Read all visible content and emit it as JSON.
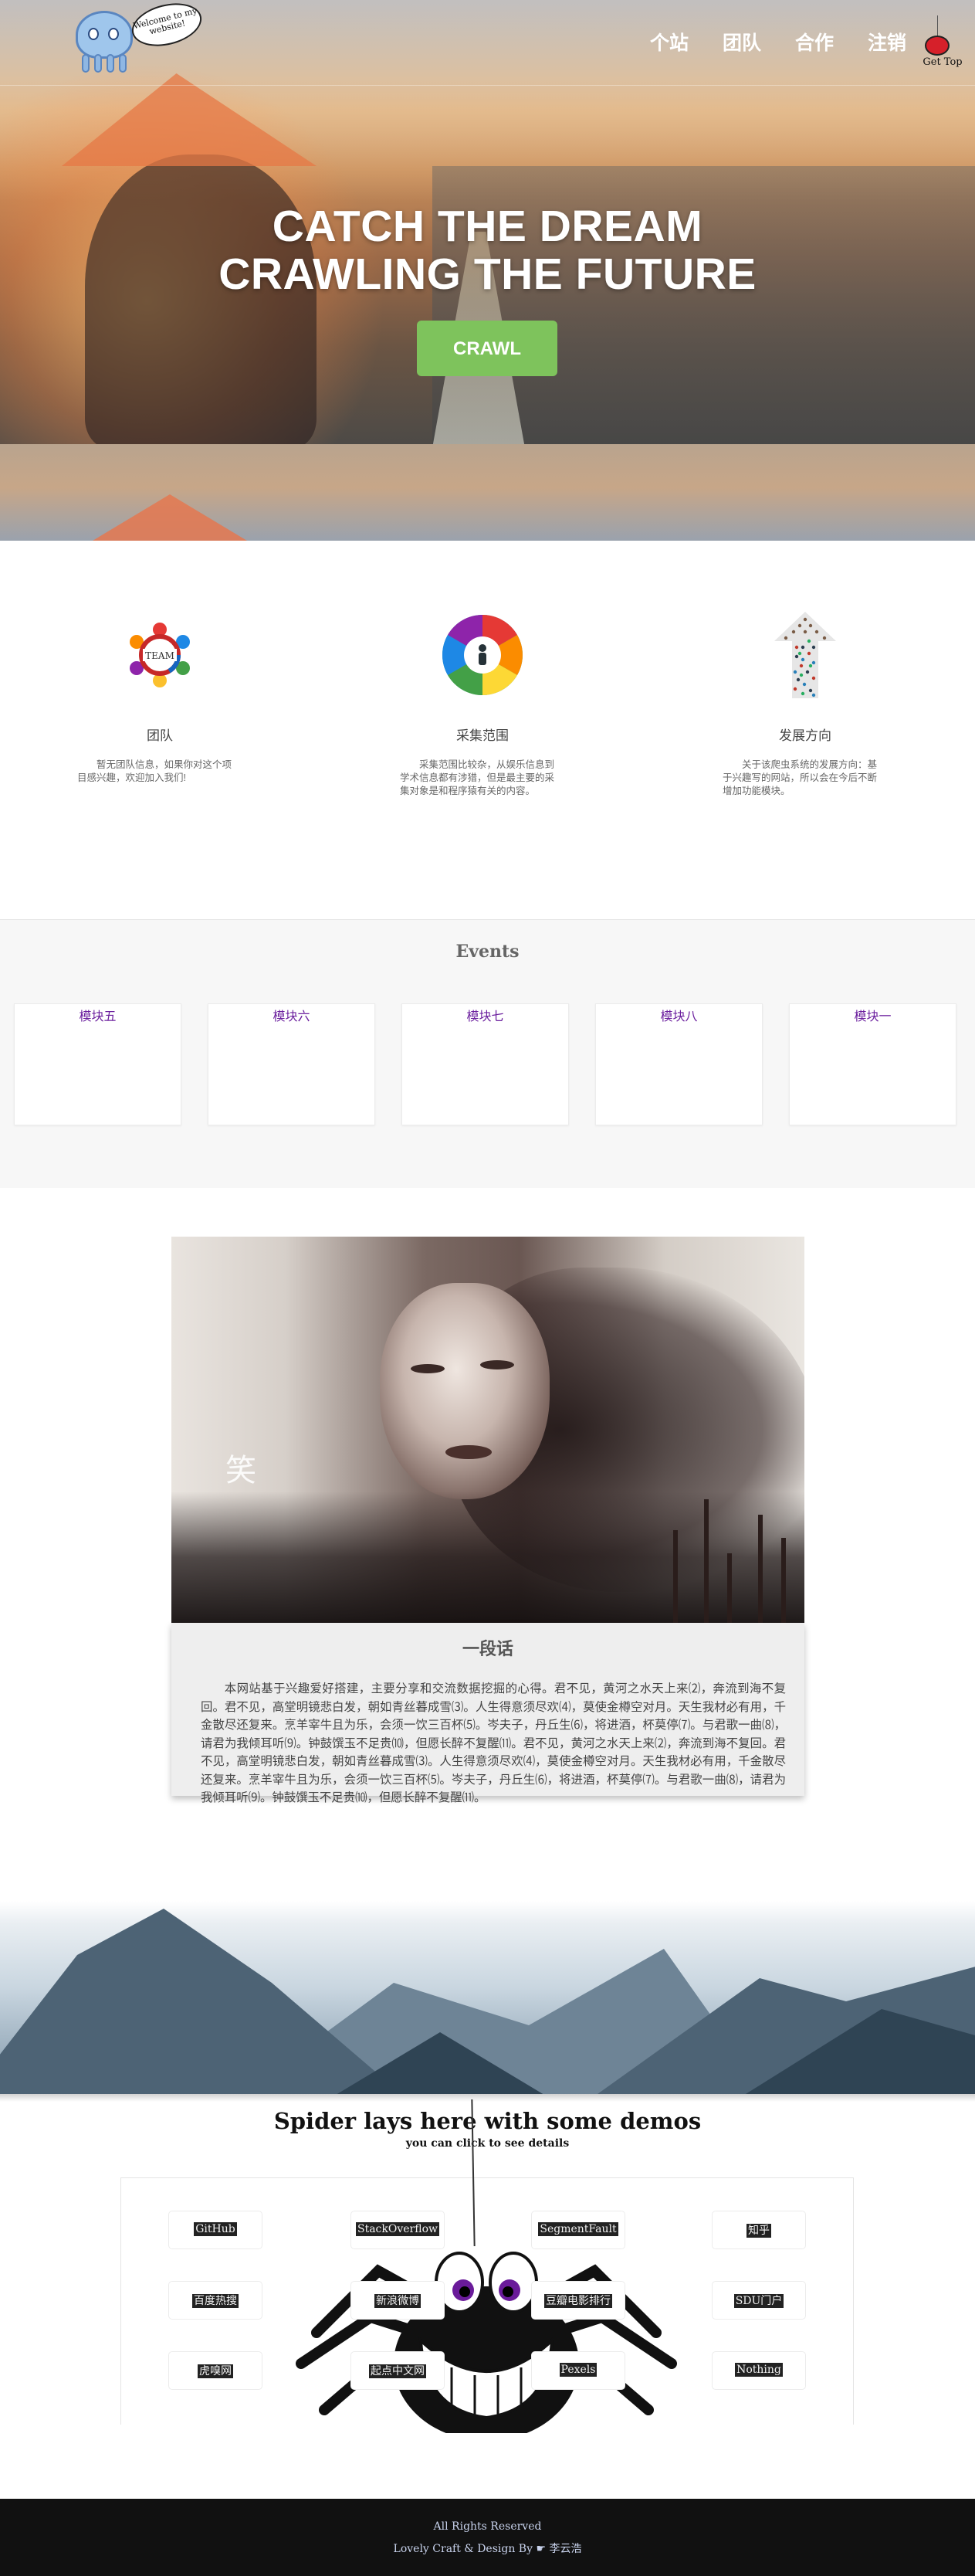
{
  "logo": {
    "bubble_text": "Welcome to my website!"
  },
  "nav": {
    "items": [
      "个站",
      "团队",
      "合作",
      "注销"
    ]
  },
  "get_top": {
    "label": "Get Top"
  },
  "hero": {
    "title_line1": "CATCH THE DREAM",
    "title_line2": "CRAWLING THE FUTURE",
    "button_label": "CRAWL"
  },
  "features": [
    {
      "icon": "team-icon",
      "title": "团队",
      "desc": "暂无团队信息，如果你对这个项目感兴趣，欢迎加入我们!"
    },
    {
      "icon": "scope-wheel-icon",
      "title": "采集范围",
      "desc": "采集范围比较杂，从娱乐信息到学术信息都有涉猎，但是最主要的采集对象是和程序猿有关的内容。"
    },
    {
      "icon": "crowd-arrow-icon",
      "title": "发展方向",
      "desc": "关于该爬虫系统的发展方向：基于兴趣写的网站，所以会在今后不断增加功能模块。"
    }
  ],
  "events": {
    "title": "Events",
    "cards": [
      "模块五",
      "模块六",
      "模块七",
      "模块八",
      "模块一"
    ]
  },
  "passage": {
    "title": "一段话",
    "text": "本网站基于兴趣爱好搭建，主要分享和交流数据挖掘的心得。君不见，黄河之水天上来⑵，奔流到海不复回。君不见，高堂明镜悲白发，朝如青丝暮成雪⑶。人生得意须尽欢⑷，莫使金樽空对月。天生我材必有用，千金散尽还复来。烹羊宰牛且为乐，会须一饮三百杯⑸。岑夫子，丹丘生⑹，将进酒，杯莫停⑺。与君歌一曲⑻，请君为我倾耳听⑼。钟鼓馔玉不足贵⑽，但愿长醉不复醒⑾。君不见，黄河之水天上来⑵，奔流到海不复回。君不见，高堂明镜悲白发，朝如青丝暮成雪⑶。人生得意须尽欢⑷，莫使金樽空对月。天生我材必有用，千金散尽还复来。烹羊宰牛且为乐，会须一饮三百杯⑸。岑夫子，丹丘生⑹，将进酒，杯莫停⑺。与君歌一曲⑻，请君为我倾耳听⑼。钟鼓馔玉不足贵⑽，但愿长醉不复醒⑾。"
  },
  "painting": {
    "glyph": "笑"
  },
  "demos": {
    "title": "Spider lays here with some demos",
    "subtitle": "you can click to see details",
    "items": [
      "GitHub",
      "StackOverflow",
      "SegmentFault",
      "知乎",
      "百度热搜",
      "新浪微博",
      "豆瓣电影排行",
      "SDU门户",
      "虎嗅网",
      "起点中文网",
      "Pexels",
      "Nothing"
    ]
  },
  "footer": {
    "line1": "All Rights Reserved",
    "line2": "Lovely Craft & Design By ☛ 李云浩"
  },
  "colors": {
    "crawl_button": "#7ec35c",
    "event_label": "#6b1f9e",
    "footer_bg": "#111111"
  }
}
